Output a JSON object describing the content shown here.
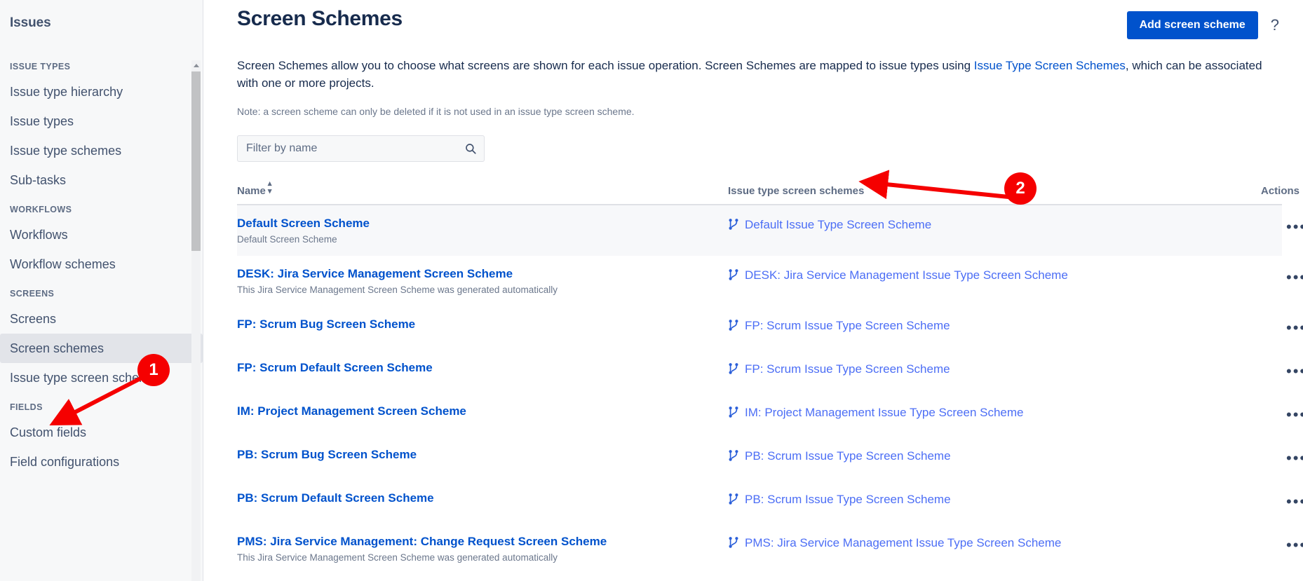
{
  "sidebar": {
    "title": "Issues",
    "groups": [
      {
        "label": "ISSUE TYPES",
        "items": [
          {
            "label": "Issue type hierarchy",
            "selected": false
          },
          {
            "label": "Issue types",
            "selected": false
          },
          {
            "label": "Issue type schemes",
            "selected": false
          },
          {
            "label": "Sub-tasks",
            "selected": false
          }
        ]
      },
      {
        "label": "WORKFLOWS",
        "items": [
          {
            "label": "Workflows",
            "selected": false
          },
          {
            "label": "Workflow schemes",
            "selected": false
          }
        ]
      },
      {
        "label": "SCREENS",
        "items": [
          {
            "label": "Screens",
            "selected": false
          },
          {
            "label": "Screen schemes",
            "selected": true
          },
          {
            "label": "Issue type screen schemes",
            "selected": false
          }
        ]
      },
      {
        "label": "FIELDS",
        "items": [
          {
            "label": "Custom fields",
            "selected": false
          },
          {
            "label": "Field configurations",
            "selected": false
          }
        ]
      }
    ]
  },
  "header": {
    "title": "Screen Schemes",
    "add_button": "Add screen scheme",
    "help_icon": "question-mark-icon"
  },
  "description": {
    "part1": "Screen Schemes allow you to choose what screens are shown for each issue operation. Screen Schemes are mapped to issue types using ",
    "link": "Issue Type Screen Schemes",
    "part2": ", which can be associated with one or more projects.",
    "note": "Note: a screen scheme can only be deleted if it is not used in an issue type screen scheme."
  },
  "filter": {
    "placeholder": "Filter by name",
    "value": "",
    "icon": "search-icon"
  },
  "table": {
    "columns": {
      "name": "Name",
      "name_sort": "▲",
      "issue_type_screen_schemes": "Issue type screen schemes",
      "actions": "Actions"
    },
    "actions_label": "•••",
    "rows": [
      {
        "name": "Default Screen Scheme",
        "description": "Default Screen Scheme",
        "schemes": [
          "Default Issue Type Screen Scheme"
        ]
      },
      {
        "name": "DESK: Jira Service Management Screen Scheme",
        "description": "This Jira Service Management Screen Scheme was generated automatically",
        "schemes": [
          "DESK: Jira Service Management Issue Type Screen Scheme"
        ]
      },
      {
        "name": "FP: Scrum Bug Screen Scheme",
        "description": "",
        "schemes": [
          "FP: Scrum Issue Type Screen Scheme"
        ]
      },
      {
        "name": "FP: Scrum Default Screen Scheme",
        "description": "",
        "schemes": [
          "FP: Scrum Issue Type Screen Scheme"
        ]
      },
      {
        "name": "IM: Project Management Screen Scheme",
        "description": "",
        "schemes": [
          "IM: Project Management Issue Type Screen Scheme"
        ]
      },
      {
        "name": "PB: Scrum Bug Screen Scheme",
        "description": "",
        "schemes": [
          "PB: Scrum Issue Type Screen Scheme"
        ]
      },
      {
        "name": "PB: Scrum Default Screen Scheme",
        "description": "",
        "schemes": [
          "PB: Scrum Issue Type Screen Scheme"
        ]
      },
      {
        "name": "PMS: Jira Service Management: Change Request Screen Scheme",
        "description": "This Jira Service Management Screen Scheme was generated automatically",
        "schemes": [
          "PMS: Jira Service Management Issue Type Screen Scheme"
        ]
      }
    ]
  },
  "annotations": [
    {
      "number": "1"
    },
    {
      "number": "2"
    }
  ],
  "colors": {
    "accent": "#0052cc",
    "link": "#4c6ef5",
    "annotation": "#f50000",
    "sidebar_bg": "#f7f8f9",
    "selected_bg": "#e2e4e9"
  }
}
